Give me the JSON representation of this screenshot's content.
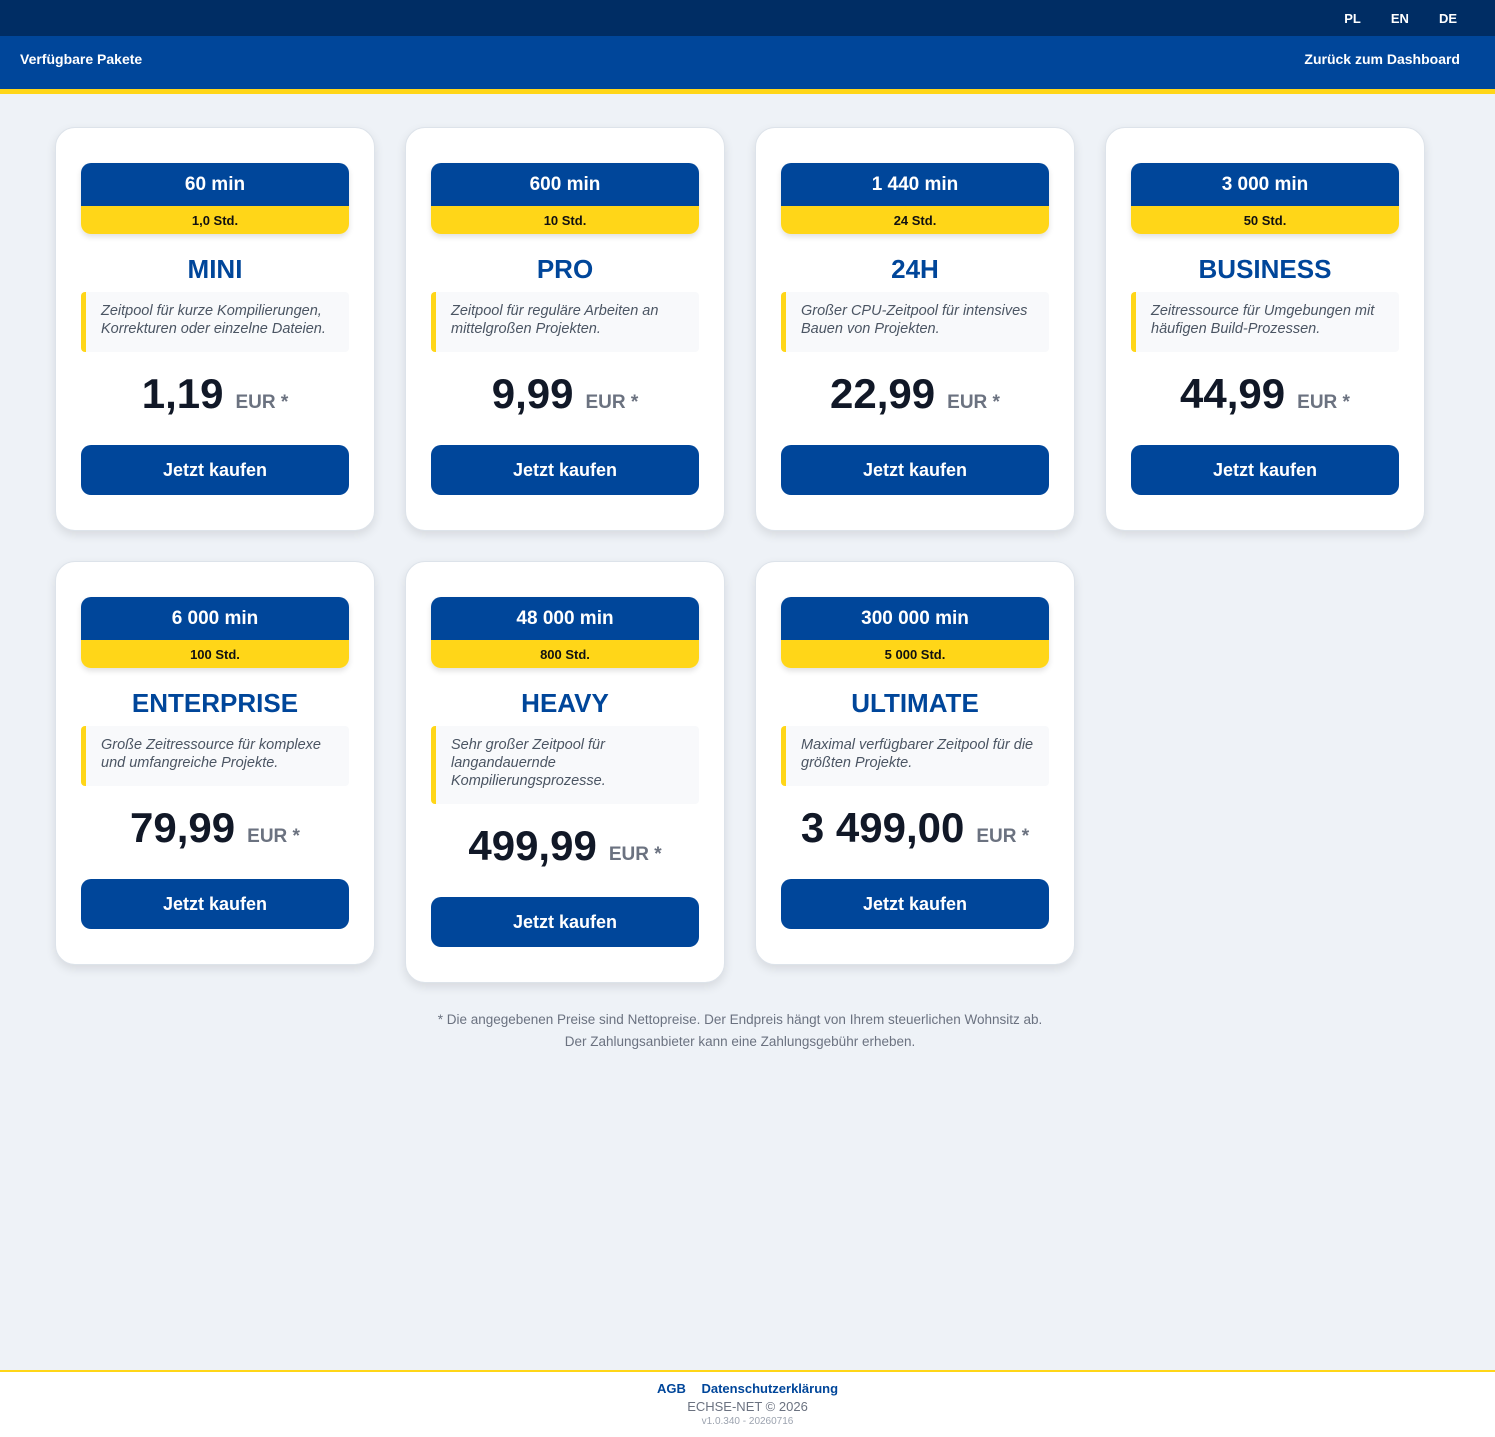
{
  "languages": [
    "PL",
    "EN",
    "DE"
  ],
  "nav": {
    "title": "Verfügbare Pakete",
    "back": "Zurück zum Dashboard"
  },
  "packages": [
    {
      "minutes": "60 min",
      "hours": "1,0 Std.",
      "name": "MINI",
      "description": "Zeitpool für kurze Kompilierungen, Korrekturen oder einzelne Dateien.",
      "price": "1,19",
      "currency": "EUR *",
      "button": "Jetzt kaufen"
    },
    {
      "minutes": "600 min",
      "hours": "10 Std.",
      "name": "PRO",
      "description": "Zeitpool für reguläre Arbeiten an mittelgroßen Projekten.",
      "price": "9,99",
      "currency": "EUR *",
      "button": "Jetzt kaufen"
    },
    {
      "minutes": "1 440 min",
      "hours": "24 Std.",
      "name": "24H",
      "description": "Großer CPU-Zeitpool für intensives Bauen von Projekten.",
      "price": "22,99",
      "currency": "EUR *",
      "button": "Jetzt kaufen"
    },
    {
      "minutes": "3 000 min",
      "hours": "50 Std.",
      "name": "BUSINESS",
      "description": "Zeitressource für Umgebungen mit häufigen Build-Prozessen.",
      "price": "44,99",
      "currency": "EUR *",
      "button": "Jetzt kaufen"
    },
    {
      "minutes": "6 000 min",
      "hours": "100 Std.",
      "name": "ENTERPRISE",
      "description": "Große Zeitressource für komplexe und umfangreiche Projekte.",
      "price": "79,99",
      "currency": "EUR *",
      "button": "Jetzt kaufen"
    },
    {
      "minutes": "48 000 min",
      "hours": "800 Std.",
      "name": "HEAVY",
      "description": "Sehr großer Zeitpool für langandauernde Kompilierungsprozesse.",
      "price": "499,99",
      "currency": "EUR *",
      "button": "Jetzt kaufen"
    },
    {
      "minutes": "300 000 min",
      "hours": "5 000 Std.",
      "name": "ULTIMATE",
      "description": "Maximal verfügbarer Zeitpool für die größten Projekte.",
      "price": "3 499,00",
      "currency": "EUR *",
      "button": "Jetzt kaufen"
    }
  ],
  "note": {
    "line1": "* Die angegebenen Preise sind Nettopreise. Der Endpreis hängt von Ihrem steuerlichen Wohnsitz ab.",
    "line2": "Der Zahlungsanbieter kann eine Zahlungsgebühr erheben."
  },
  "footer": {
    "links": [
      "AGB",
      "Datenschutzerklärung"
    ],
    "copyright": "ECHSE-NET © 2026",
    "version": "v1.0.340 - 20260716"
  },
  "colors": {
    "primary": "#00469a",
    "top_bar": "#002d64",
    "accent": "#ffd618",
    "background": "#eef2f7"
  }
}
